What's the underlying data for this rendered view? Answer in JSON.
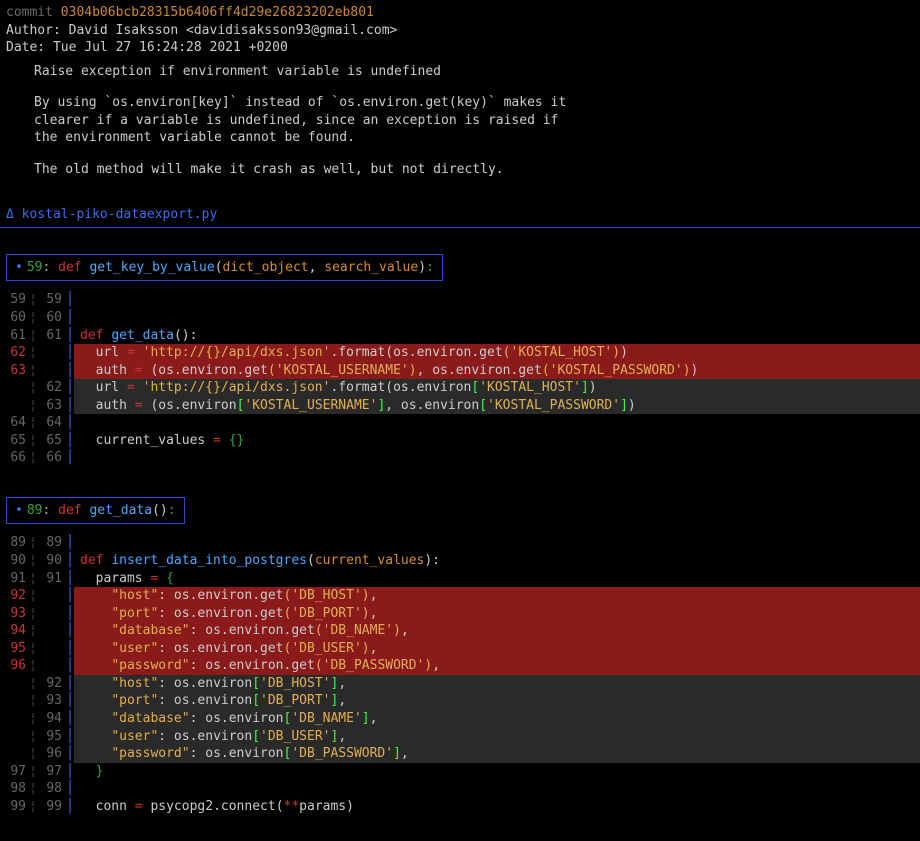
{
  "commit": {
    "prefix": "commit ",
    "hash": "0304b06bcb28315b6406ff4d29e26823202eb801",
    "author_label": "Author: ",
    "author": "David Isaksson <davidisaksson93@gmail.com>",
    "date_label": "Date:   ",
    "date": "Tue Jul 27 16:24:28 2021 +0200",
    "title": "Raise exception if environment variable is undefined",
    "body1": "By using `os.environ[key]` instead of `os.environ.get(key)` makes it",
    "body2": "clearer if a variable is undefined, since an exception is raised if",
    "body3": "the environment variable cannot be found.",
    "body4": "The old method will make it crash as well, but not directly."
  },
  "file": {
    "delta": "Δ",
    "name": "kostal-piko-dataexport.py"
  },
  "hunk1": {
    "dot": "•",
    "lineno": "59",
    "sep": ": ",
    "def": "def ",
    "fn": "get_key_by_value",
    "params_open": "(",
    "p1": "dict_object",
    "comma": ", ",
    "p2": "search_value",
    "params_close": ")",
    "colon": ":",
    "rows": [
      {
        "old": "59",
        "new": "59",
        "type": "ctx",
        "code": ""
      },
      {
        "old": "60",
        "new": "60",
        "type": "ctx",
        "code": ""
      },
      {
        "old": "61",
        "new": "61",
        "type": "ctx",
        "tokens": [
          {
            "t": "kw",
            "v": "def "
          },
          {
            "t": "fn",
            "v": "get_data"
          },
          {
            "t": "paren",
            "v": "()"
          },
          {
            "t": "colon",
            "v": ":"
          }
        ]
      },
      {
        "old": "62",
        "new": "",
        "type": "del",
        "tokens": [
          {
            "t": "plain",
            "v": "  url "
          },
          {
            "t": "eq",
            "v": "= "
          },
          {
            "t": "str",
            "v": "'http://{}/api/dxs.json'"
          },
          {
            "t": "plain",
            "v": ".format"
          },
          {
            "t": "paren",
            "v": "("
          },
          {
            "t": "plain",
            "v": "os.environ.get"
          },
          {
            "t": "paren2",
            "v": "("
          },
          {
            "t": "str",
            "v": "'KOSTAL_HOST'"
          },
          {
            "t": "paren2",
            "v": ")"
          },
          {
            "t": "paren",
            "v": ")"
          }
        ]
      },
      {
        "old": "63",
        "new": "",
        "type": "del",
        "tokens": [
          {
            "t": "plain",
            "v": "  auth "
          },
          {
            "t": "eq",
            "v": "= "
          },
          {
            "t": "paren",
            "v": "("
          },
          {
            "t": "plain",
            "v": "os.environ.get"
          },
          {
            "t": "paren2",
            "v": "("
          },
          {
            "t": "str",
            "v": "'KOSTAL_USERNAME'"
          },
          {
            "t": "paren2",
            "v": ")"
          },
          {
            "t": "plain",
            "v": ", os.environ.get"
          },
          {
            "t": "paren2",
            "v": "("
          },
          {
            "t": "str",
            "v": "'KOSTAL_PASSWORD'"
          },
          {
            "t": "paren2",
            "v": ")"
          },
          {
            "t": "paren",
            "v": ")"
          }
        ]
      },
      {
        "old": "",
        "new": "62",
        "type": "add",
        "tokens": [
          {
            "t": "plain",
            "v": "  url "
          },
          {
            "t": "eq",
            "v": "= "
          },
          {
            "t": "str",
            "v": "'http://{}/api/dxs.json'"
          },
          {
            "t": "plain",
            "v": ".format"
          },
          {
            "t": "paren",
            "v": "("
          },
          {
            "t": "plain",
            "v": "os.environ"
          },
          {
            "t": "br",
            "v": "["
          },
          {
            "t": "str",
            "v": "'KOSTAL_HOST'"
          },
          {
            "t": "br",
            "v": "]"
          },
          {
            "t": "paren",
            "v": ")"
          }
        ]
      },
      {
        "old": "",
        "new": "63",
        "type": "add",
        "tokens": [
          {
            "t": "plain",
            "v": "  auth "
          },
          {
            "t": "eq",
            "v": "= "
          },
          {
            "t": "paren",
            "v": "("
          },
          {
            "t": "plain",
            "v": "os.environ"
          },
          {
            "t": "br",
            "v": "["
          },
          {
            "t": "str",
            "v": "'KOSTAL_USERNAME'"
          },
          {
            "t": "br",
            "v": "]"
          },
          {
            "t": "plain",
            "v": ", os.environ"
          },
          {
            "t": "br",
            "v": "["
          },
          {
            "t": "str",
            "v": "'KOSTAL_PASSWORD'"
          },
          {
            "t": "br",
            "v": "]"
          },
          {
            "t": "paren",
            "v": ")"
          }
        ]
      },
      {
        "old": "64",
        "new": "64",
        "type": "ctx",
        "code": ""
      },
      {
        "old": "65",
        "new": "65",
        "type": "ctx",
        "tokens": [
          {
            "t": "plain",
            "v": "  current_values "
          },
          {
            "t": "eq",
            "v": "= "
          },
          {
            "t": "brace",
            "v": "{}"
          }
        ]
      },
      {
        "old": "66",
        "new": "66",
        "type": "ctx",
        "code": ""
      }
    ]
  },
  "hunk2": {
    "dot": "•",
    "lineno": "89",
    "sep": ": ",
    "def": "def ",
    "fn": "get_data",
    "params_open": "(",
    "params_close": ")",
    "colon": ":",
    "rows": [
      {
        "old": "89",
        "new": "89",
        "type": "ctx",
        "code": ""
      },
      {
        "old": "90",
        "new": "90",
        "type": "ctx",
        "tokens": [
          {
            "t": "kw",
            "v": "def "
          },
          {
            "t": "fn",
            "v": "insert_data_into_postgres"
          },
          {
            "t": "paren",
            "v": "("
          },
          {
            "t": "param",
            "v": "current_values"
          },
          {
            "t": "paren",
            "v": ")"
          },
          {
            "t": "colon",
            "v": ":"
          }
        ]
      },
      {
        "old": "91",
        "new": "91",
        "type": "ctx",
        "tokens": [
          {
            "t": "plain",
            "v": "  params "
          },
          {
            "t": "eq",
            "v": "= "
          },
          {
            "t": "brace",
            "v": "{"
          }
        ]
      },
      {
        "old": "92",
        "new": "",
        "type": "del",
        "tokens": [
          {
            "t": "plain",
            "v": "    "
          },
          {
            "t": "str",
            "v": "\"host\""
          },
          {
            "t": "plain",
            "v": ": os.environ.get"
          },
          {
            "t": "paren2",
            "v": "("
          },
          {
            "t": "str",
            "v": "'DB_HOST'"
          },
          {
            "t": "paren2",
            "v": ")"
          },
          {
            "t": "plain",
            "v": ","
          }
        ]
      },
      {
        "old": "93",
        "new": "",
        "type": "del",
        "tokens": [
          {
            "t": "plain",
            "v": "    "
          },
          {
            "t": "str",
            "v": "\"port\""
          },
          {
            "t": "plain",
            "v": ": os.environ.get"
          },
          {
            "t": "paren2",
            "v": "("
          },
          {
            "t": "str",
            "v": "'DB_PORT'"
          },
          {
            "t": "paren2",
            "v": ")"
          },
          {
            "t": "plain",
            "v": ","
          }
        ]
      },
      {
        "old": "94",
        "new": "",
        "type": "del",
        "tokens": [
          {
            "t": "plain",
            "v": "    "
          },
          {
            "t": "str",
            "v": "\"database\""
          },
          {
            "t": "plain",
            "v": ": os.environ.get"
          },
          {
            "t": "paren2",
            "v": "("
          },
          {
            "t": "str",
            "v": "'DB_NAME'"
          },
          {
            "t": "paren2",
            "v": ")"
          },
          {
            "t": "plain",
            "v": ","
          }
        ]
      },
      {
        "old": "95",
        "new": "",
        "type": "del",
        "tokens": [
          {
            "t": "plain",
            "v": "    "
          },
          {
            "t": "str",
            "v": "\"user\""
          },
          {
            "t": "plain",
            "v": ": os.environ.get"
          },
          {
            "t": "paren2",
            "v": "("
          },
          {
            "t": "str",
            "v": "'DB_USER'"
          },
          {
            "t": "paren2",
            "v": ")"
          },
          {
            "t": "plain",
            "v": ","
          }
        ]
      },
      {
        "old": "96",
        "new": "",
        "type": "del",
        "tokens": [
          {
            "t": "plain",
            "v": "    "
          },
          {
            "t": "str",
            "v": "\"password\""
          },
          {
            "t": "plain",
            "v": ": os.environ.get"
          },
          {
            "t": "paren2",
            "v": "("
          },
          {
            "t": "str",
            "v": "'DB_PASSWORD'"
          },
          {
            "t": "paren2",
            "v": ")"
          },
          {
            "t": "plain",
            "v": ","
          }
        ]
      },
      {
        "old": "",
        "new": "92",
        "type": "add",
        "tokens": [
          {
            "t": "plain",
            "v": "    "
          },
          {
            "t": "str",
            "v": "\"host\""
          },
          {
            "t": "plain",
            "v": ": os.environ"
          },
          {
            "t": "br",
            "v": "["
          },
          {
            "t": "str",
            "v": "'DB_HOST'"
          },
          {
            "t": "br",
            "v": "]"
          },
          {
            "t": "plain",
            "v": ","
          }
        ]
      },
      {
        "old": "",
        "new": "93",
        "type": "add",
        "tokens": [
          {
            "t": "plain",
            "v": "    "
          },
          {
            "t": "str",
            "v": "\"port\""
          },
          {
            "t": "plain",
            "v": ": os.environ"
          },
          {
            "t": "br",
            "v": "["
          },
          {
            "t": "str",
            "v": "'DB_PORT'"
          },
          {
            "t": "br",
            "v": "]"
          },
          {
            "t": "plain",
            "v": ","
          }
        ]
      },
      {
        "old": "",
        "new": "94",
        "type": "add",
        "tokens": [
          {
            "t": "plain",
            "v": "    "
          },
          {
            "t": "str",
            "v": "\"database\""
          },
          {
            "t": "plain",
            "v": ": os.environ"
          },
          {
            "t": "br",
            "v": "["
          },
          {
            "t": "str",
            "v": "'DB_NAME'"
          },
          {
            "t": "br",
            "v": "]"
          },
          {
            "t": "plain",
            "v": ","
          }
        ]
      },
      {
        "old": "",
        "new": "95",
        "type": "add",
        "tokens": [
          {
            "t": "plain",
            "v": "    "
          },
          {
            "t": "str",
            "v": "\"user\""
          },
          {
            "t": "plain",
            "v": ": os.environ"
          },
          {
            "t": "br",
            "v": "["
          },
          {
            "t": "str",
            "v": "'DB_USER'"
          },
          {
            "t": "br",
            "v": "]"
          },
          {
            "t": "plain",
            "v": ","
          }
        ]
      },
      {
        "old": "",
        "new": "96",
        "type": "add",
        "tokens": [
          {
            "t": "plain",
            "v": "    "
          },
          {
            "t": "str",
            "v": "\"password\""
          },
          {
            "t": "plain",
            "v": ": os.environ"
          },
          {
            "t": "br",
            "v": "["
          },
          {
            "t": "str",
            "v": "'DB_PASSWORD'"
          },
          {
            "t": "br",
            "v": "]"
          },
          {
            "t": "plain",
            "v": ","
          }
        ]
      },
      {
        "old": "97",
        "new": "97",
        "type": "ctx",
        "tokens": [
          {
            "t": "plain",
            "v": "  "
          },
          {
            "t": "brace",
            "v": "}"
          }
        ]
      },
      {
        "old": "98",
        "new": "98",
        "type": "ctx",
        "code": ""
      },
      {
        "old": "99",
        "new": "99",
        "type": "ctx",
        "tokens": [
          {
            "t": "plain",
            "v": "  conn "
          },
          {
            "t": "eq",
            "v": "= "
          },
          {
            "t": "plain",
            "v": "psycopg2.connect"
          },
          {
            "t": "paren",
            "v": "("
          },
          {
            "t": "eq",
            "v": "**"
          },
          {
            "t": "plain",
            "v": "params"
          },
          {
            "t": "paren",
            "v": ")"
          }
        ]
      }
    ]
  },
  "bar": "│",
  "sep_dot": "¦"
}
